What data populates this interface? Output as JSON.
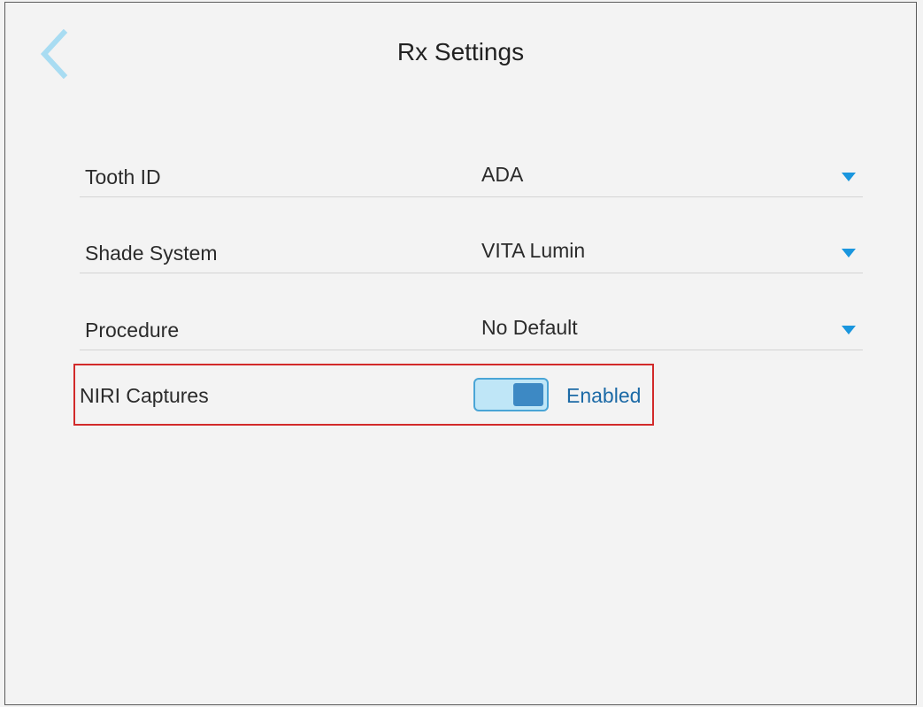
{
  "header": {
    "title": "Rx Settings"
  },
  "settings": [
    {
      "label": "Tooth ID",
      "value": "ADA"
    },
    {
      "label": "Shade System",
      "value": "VITA Lumin"
    },
    {
      "label": "Procedure",
      "value": "No Default"
    }
  ],
  "niri": {
    "label": "NIRI Captures",
    "state_label": "Enabled",
    "enabled": true
  },
  "icons": {
    "back": "chevron-left-icon",
    "dropdown": "caret-down-icon"
  },
  "colors": {
    "background": "#f3f3f3",
    "accent": "#1a96de",
    "toggle_track": "#bfe6f7",
    "toggle_knob": "#3d89c4",
    "enabled_text": "#1c6aa6",
    "highlight": "#d22a2a",
    "back_chevron": "#a8dcf2"
  }
}
